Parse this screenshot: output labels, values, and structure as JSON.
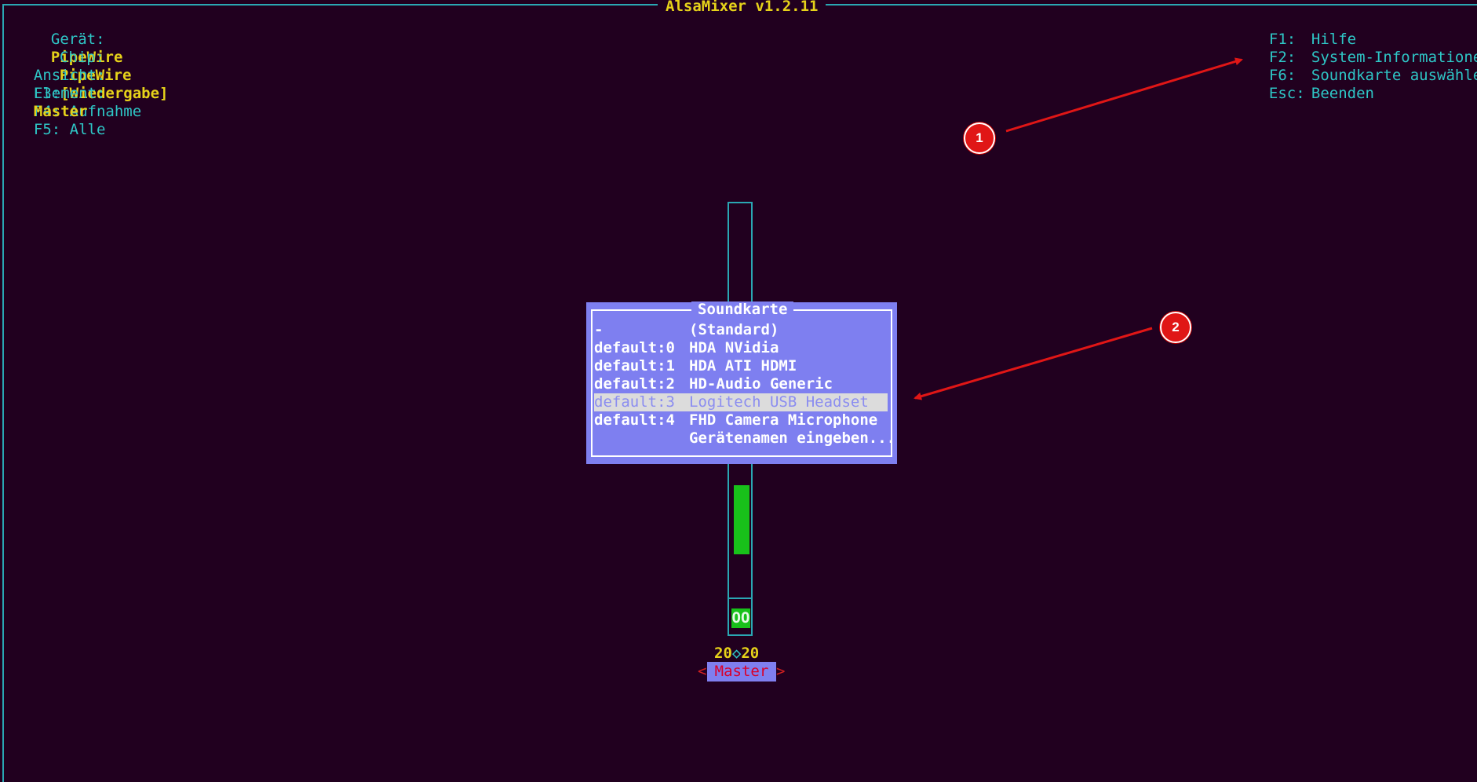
{
  "window": {
    "title": "AlsaMixer v1.2.11"
  },
  "info": {
    "device_label": "Gerät:",
    "device_value": "PipeWire",
    "chip_label": "Chip:",
    "chip_value": "PipeWire",
    "view_label": "Ansicht:",
    "view_f3_key": "F3:",
    "view_f3_value": "[Wiedergabe]",
    "view_f4": "F4: Aufnahme",
    "view_f5": "F5: Alle",
    "element_label": "Element:",
    "element_value": "Master"
  },
  "keys": [
    {
      "key": "F1:",
      "label": "Hilfe"
    },
    {
      "key": "F2:",
      "label": "System-Informationen"
    },
    {
      "key": "F6:",
      "label": "Soundkarte auswählen"
    },
    {
      "key": "Esc:",
      "label": "Beenden"
    }
  ],
  "channel": {
    "name": "Master",
    "volume_left": "20",
    "volume_right": "20",
    "volume_fraction": 0.2,
    "mute_label": "OO",
    "arrow_left": "<",
    "arrow_right": ">",
    "diamond": "◇"
  },
  "dialog": {
    "title": "Soundkarte",
    "items": [
      {
        "id": "-",
        "name": "(Standard)",
        "selected": false
      },
      {
        "id": "default:0",
        "name": "HDA NVidia",
        "selected": false
      },
      {
        "id": "default:1",
        "name": "HDA ATI HDMI",
        "selected": false
      },
      {
        "id": "default:2",
        "name": "HD-Audio Generic",
        "selected": false
      },
      {
        "id": "default:3",
        "name": "Logitech USB Headset",
        "selected": true
      },
      {
        "id": "default:4",
        "name": "FHD Camera Microphone",
        "selected": false
      },
      {
        "id": "",
        "name": "Gerätenamen eingeben...",
        "selected": false
      }
    ]
  },
  "annotations": {
    "marker_1": "1",
    "marker_2": "2",
    "arrow_color": "#e01616"
  }
}
